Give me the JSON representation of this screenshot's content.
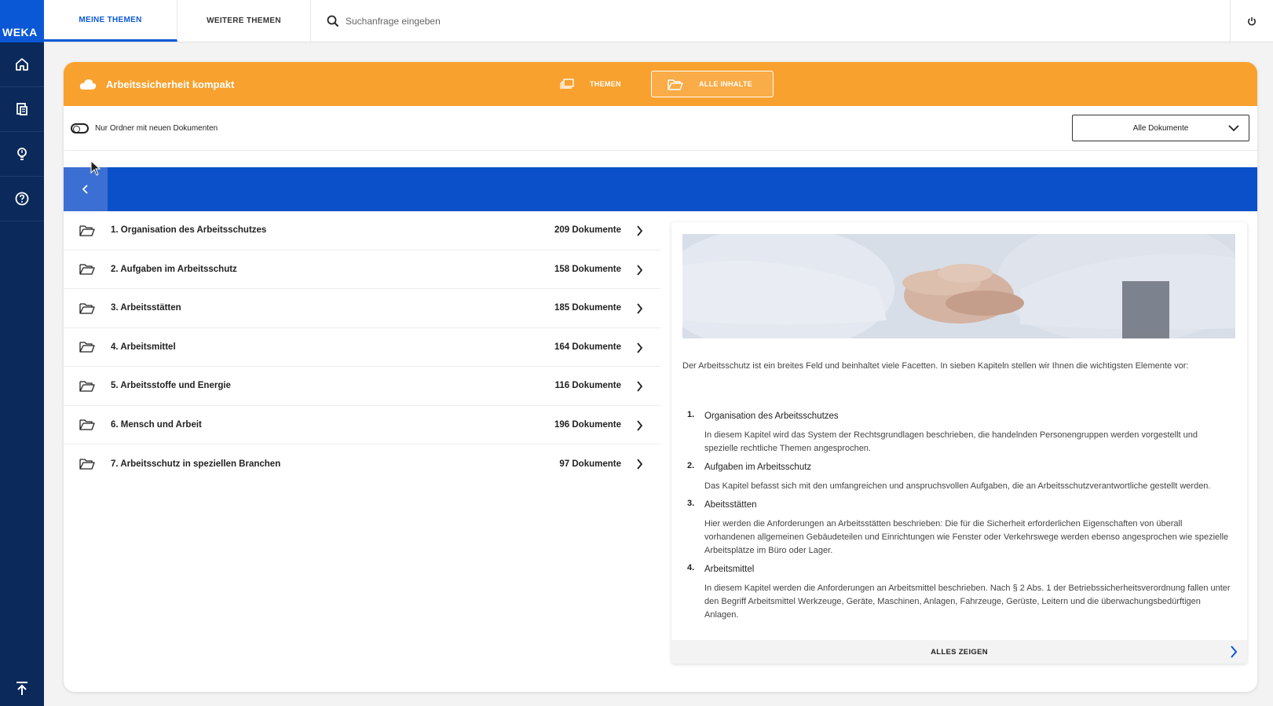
{
  "rail": {
    "logo": "WEKA"
  },
  "topbar": {
    "tabs": [
      {
        "label": "MEINE THEMEN"
      },
      {
        "label": "WEITERE THEMEN"
      }
    ],
    "search_placeholder": "Suchanfrage eingeben"
  },
  "header": {
    "title": "Arbeitssicherheit kompakt",
    "tab_themen": "THEMEN",
    "tab_alle": "ALLE INHALTE"
  },
  "filter": {
    "toggle_label": "Nur Ordner mit neuen Dokumenten",
    "dropdown_value": "Alle Dokumente"
  },
  "folders": [
    {
      "name": "1. Organisation des Arbeitsschutzes",
      "count": "209 Dokumente"
    },
    {
      "name": "2. Aufgaben im Arbeitsschutz",
      "count": "158 Dokumente"
    },
    {
      "name": "3. Arbeitsstätten",
      "count": "185 Dokumente"
    },
    {
      "name": "4. Arbeitsmittel",
      "count": "164 Dokumente"
    },
    {
      "name": "5. Arbeitsstoffe und Energie",
      "count": "116 Dokumente"
    },
    {
      "name": "6. Mensch und Arbeit",
      "count": "196 Dokumente"
    },
    {
      "name": "7. Arbeitsschutz in speziellen Branchen",
      "count": "97 Dokumente"
    }
  ],
  "panel": {
    "intro": "Der Arbeitsschutz ist ein breites Feld und beinhaltet viele Facetten. In sieben Kapiteln stellen wir Ihnen die wichtigsten Elemente vor:",
    "items": [
      {
        "num": "1.",
        "title": "Organisation des Arbeitsschutzes",
        "text": "In diesem Kapitel wird das System der Rechtsgrundlagen beschrieben, die handelnden Personengruppen werden vorgestellt und spezielle rechtliche Themen angesprochen."
      },
      {
        "num": "2.",
        "title": "Aufgaben im Arbeitsschutz",
        "text": "Das Kapitel befasst sich mit den umfangreichen und anspruchsvollen Aufgaben, die an Arbeitsschutzverantwortliche gestellt werden."
      },
      {
        "num": "3.",
        "title": "Abeitsstätten",
        "text": "Hier werden die Anforderungen an Arbeitsstätten beschrieben: Die für die Sicherheit erforderlichen Eigenschaften von überall vorhandenen allgemeinen Gebäudeteilen und Einrichtungen wie Fenster oder Verkehrswege werden ebenso angesprochen wie spezielle Arbeitsplätze im Büro oder Lager."
      },
      {
        "num": "4.",
        "title": "Arbeitsmittel",
        "text": "In diesem Kapitel werden die Anforderungen an Arbeitsmittel beschrieben. Nach § 2 Abs. 1 der Betriebssicherheitsverordnung fallen unter den Begriff Arbeitsmittel Werkzeuge, Geräte, Maschinen, Anlagen, Fahrzeuge, Gerüste, Leitern und die überwachungsbedürftigen Anlagen."
      }
    ],
    "show_all": "ALLES ZEIGEN"
  },
  "colors": {
    "brand_blue": "#0b58d6",
    "rail_navy": "#0b2a5b",
    "header_orange": "#f9a12e",
    "band_blue": "#0b50c8"
  }
}
